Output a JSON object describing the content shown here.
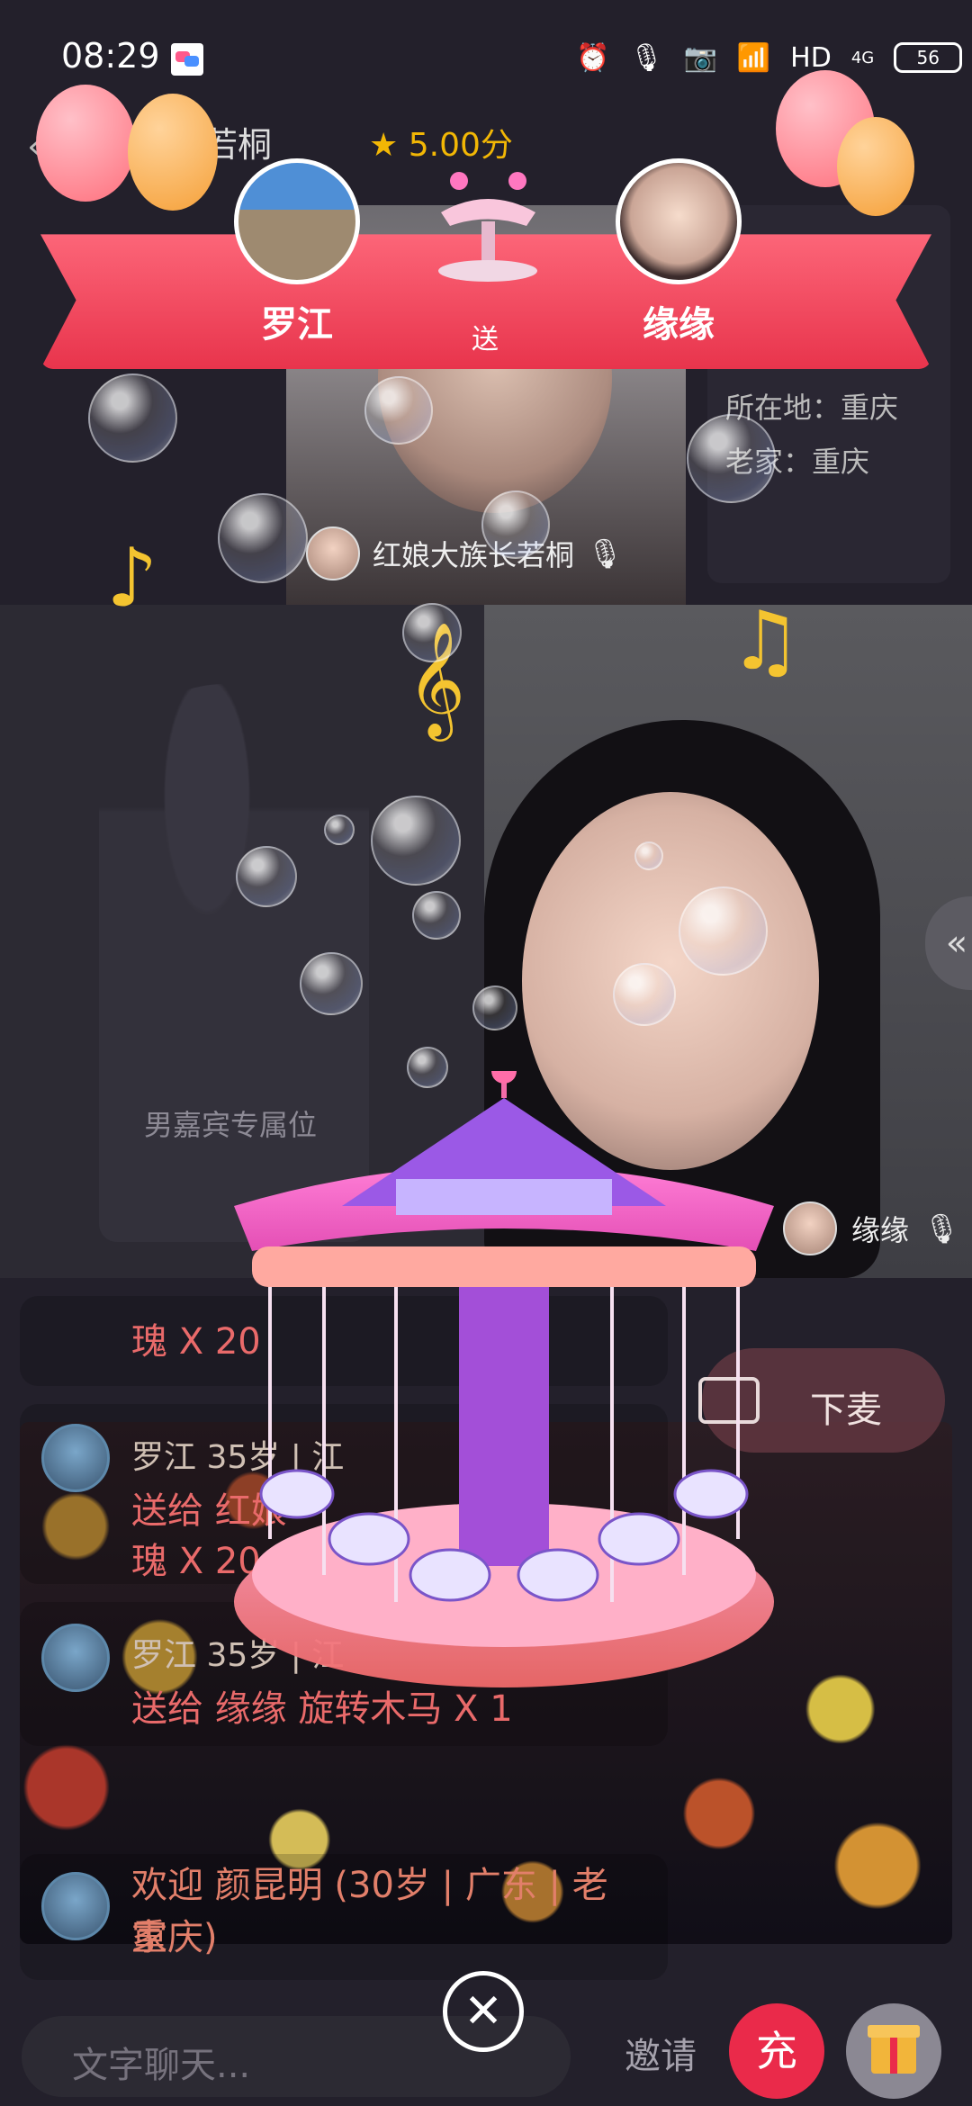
{
  "status_bar": {
    "time": "08:29",
    "network_label": "HD",
    "signal_label": "4G",
    "battery": "56"
  },
  "host": {
    "title": "族长若桐",
    "rating": "5.00分",
    "name_label": "红娘大族长若桐"
  },
  "profile_info": {
    "location": "所在地：重庆",
    "hometown": "老家：重庆"
  },
  "banner": {
    "sender": "罗江",
    "action": "送",
    "receiver": "缘缘"
  },
  "male_slot": {
    "label": "男嘉宾专属位"
  },
  "female_slot": {
    "name": "缘缘"
  },
  "chat": {
    "messages": [
      {
        "line1": "瑰 X 20"
      },
      {
        "name": "罗江 35岁 | 江",
        "line1": "送给 红娘",
        "line2": "瑰 X 20"
      },
      {
        "name": "罗江 35岁 | 江",
        "line1": "送给 缘缘 旋转木马 X 1"
      },
      {
        "line1": "欢迎 颜昆明 (30岁 | 广东 | 老家",
        "line2": "重庆)"
      }
    ]
  },
  "controls": {
    "leave_label": "下麦",
    "chat_placeholder": "文字聊天...",
    "invite_label": "邀请",
    "recharge_label": "充",
    "side_tab_label": "«"
  },
  "colors": {
    "banner": "#e8344c",
    "accent_gold": "#f4c430",
    "recharge": "#ea2a4a"
  },
  "icons": [
    "alarm-icon",
    "mic-icon",
    "camera-icon",
    "wifi-icon",
    "signal-icon",
    "battery-icon",
    "star-icon",
    "back-icon",
    "mic-small-icon",
    "video-camera-icon",
    "close-icon",
    "gift-icon",
    "music-note-icon",
    "treble-clef-icon"
  ]
}
